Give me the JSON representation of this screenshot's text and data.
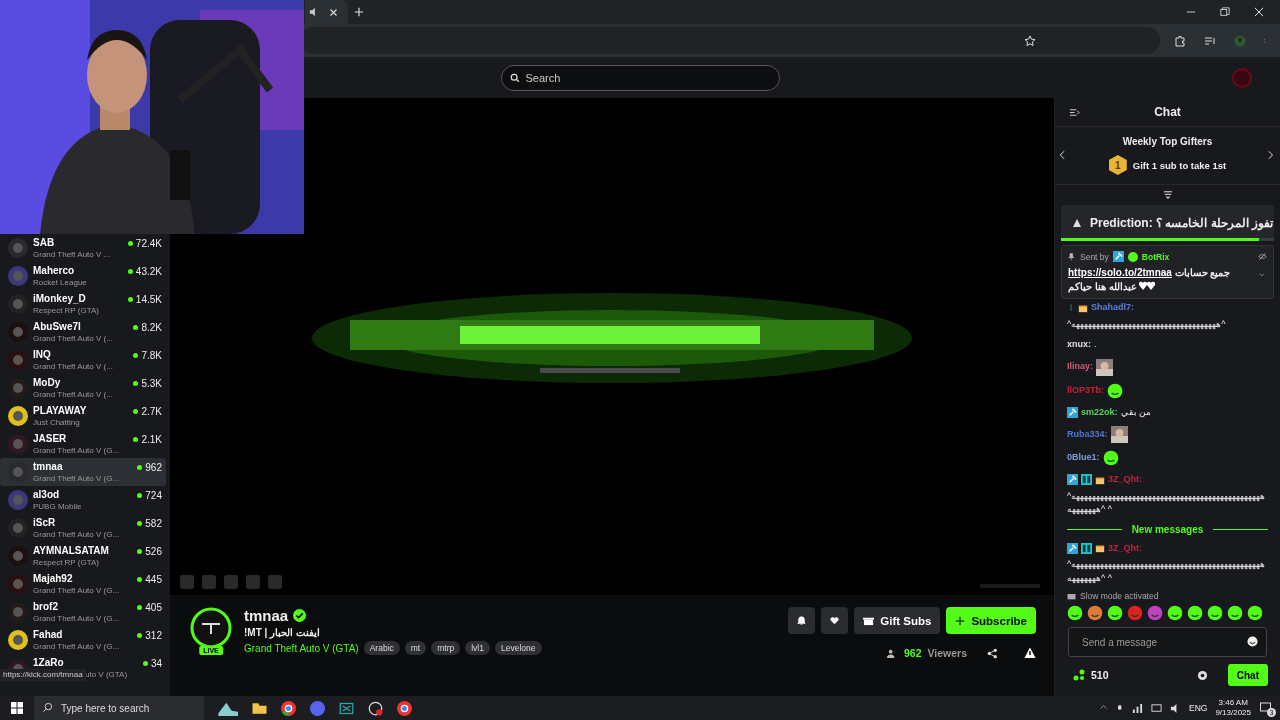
{
  "header": {
    "search": {
      "placeholder": "Search"
    }
  },
  "sidebar": {
    "channels": [
      {
        "name": "SAB",
        "game": "Grand Theft Auto V ...",
        "viewers": "72.4K",
        "selected": false
      },
      {
        "name": "Maherco",
        "game": "Rocket League",
        "viewers": "43.2K",
        "selected": false
      },
      {
        "name": "iMonkey_D",
        "game": "Respect RP (GTA)",
        "viewers": "14.5K",
        "selected": false
      },
      {
        "name": "AbuSwe7l",
        "game": "Grand Theft Auto V (...",
        "viewers": "8.2K",
        "selected": false
      },
      {
        "name": "INQ",
        "game": "Grand Theft Auto V (...",
        "viewers": "7.8K",
        "selected": false
      },
      {
        "name": "MoDy",
        "game": "Grand Theft Auto V (...",
        "viewers": "5.3K",
        "selected": false
      },
      {
        "name": "PLAYAWAY",
        "game": "Just Chatting",
        "viewers": "2.7K",
        "selected": false
      },
      {
        "name": "JASER",
        "game": "Grand Theft Auto V (G...",
        "viewers": "2.1K",
        "selected": false
      },
      {
        "name": "tmnaa",
        "game": "Grand Theft Auto V (G...",
        "viewers": "962",
        "selected": true
      },
      {
        "name": "al3od",
        "game": "PUBG Mobile",
        "viewers": "724",
        "selected": false
      },
      {
        "name": "iScR",
        "game": "Grand Theft Auto V (G...",
        "viewers": "582",
        "selected": false
      },
      {
        "name": "AYMNALSATAM",
        "game": "Respect RP (GTA)",
        "viewers": "526",
        "selected": false
      },
      {
        "name": "Majah92",
        "game": "Grand Theft Auto V (G...",
        "viewers": "445",
        "selected": false
      },
      {
        "name": "brof2",
        "game": "Grand Theft Auto V (G...",
        "viewers": "405",
        "selected": false
      },
      {
        "name": "Fahad",
        "game": "Grand Theft Auto V (G...",
        "viewers": "312",
        "selected": false
      },
      {
        "name": "1ZaRo",
        "game": "uto V (GTA)",
        "viewers": "34",
        "selected": false
      }
    ],
    "link_preview": "https://kick.com/tmnaa"
  },
  "stream": {
    "channel": "tmnaa",
    "live_badge": "LIVE",
    "title": "!MT | ايفنت الحبار",
    "category": "Grand Theft Auto V (GTA)",
    "tags": [
      "Arabic",
      "mt",
      "mtrp",
      "lvl1",
      "Levelone"
    ],
    "gift_button": "Gift Subs",
    "subscribe_button": "Subscribe",
    "viewer_count": "962",
    "viewers_label": "Viewers"
  },
  "chat": {
    "title": "Chat",
    "gifters": {
      "title": "Weekly Top Gifters",
      "rank": "1",
      "text": "Gift 1 sub to take 1st"
    },
    "prediction": {
      "text": "Prediction: تفوز المرحلة الخامسه ؟",
      "level": 0.93
    },
    "pinned": {
      "sent_by": "Sent by",
      "author": "BotRix",
      "link": "https://solo.to/2tmnaa",
      "text": "جميع حسابات عبدالله هنا حياكم"
    },
    "messages": [
      {
        "user": "Shahadl7:",
        "color": "#5b7fd6",
        "sub": true,
        "mod": false,
        "og": false,
        "gift": true,
        "text": "^ههههههههههههههههههههههههههههههههههههه^",
        "kind": "text"
      },
      {
        "user": "xnux:",
        "color": "#e0e0e0",
        "sub": false,
        "mod": false,
        "og": false,
        "gift": false,
        "text": ".",
        "kind": "text"
      },
      {
        "user": "Ilinay:",
        "color": "#d45b7a",
        "sub": false,
        "mod": false,
        "og": false,
        "gift": false,
        "kind": "emote"
      },
      {
        "user": "llOP3Tb:",
        "color": "#c0243c",
        "sub": false,
        "mod": false,
        "og": false,
        "gift": false,
        "kind": "emote"
      },
      {
        "user": "sm22ok:",
        "color": "#5ad25a",
        "sub": false,
        "mod": true,
        "og": false,
        "gift": false,
        "text": "من بقي",
        "kind": "text"
      },
      {
        "user": "Ruba334:",
        "color": "#4a78d0",
        "sub": false,
        "mod": false,
        "og": false,
        "gift": false,
        "kind": "emote"
      },
      {
        "user": "0Blue1:",
        "color": "#7aa0e0",
        "sub": false,
        "mod": false,
        "og": false,
        "gift": false,
        "kind": "emote"
      },
      {
        "user": "3Z_Qht:",
        "color": "#c0243c",
        "sub": false,
        "mod": true,
        "og": true,
        "gift": true,
        "text": "^هههههههههههههههههههههههههههههههههههههههههههههههه^ ^هههههههه",
        "kind": "text"
      },
      {
        "kind": "divider",
        "text": "New messages"
      },
      {
        "user": "3Z_Qht:",
        "color": "#c0243c",
        "sub": false,
        "mod": true,
        "og": true,
        "gift": true,
        "text": "^هههههههههههههههههههههههههههههههههههههههههههههههه^ ^هههههههه",
        "kind": "text"
      }
    ],
    "slow_mode": "Slow mode activated",
    "input": {
      "placeholder": "Send a message"
    },
    "points": "510",
    "send_button": "Chat"
  },
  "taskbar": {
    "search": {
      "placeholder": "Type here to search"
    },
    "language": "ENG",
    "time": "3:46 AM",
    "date": "9/13/2025",
    "notifications": "3"
  }
}
